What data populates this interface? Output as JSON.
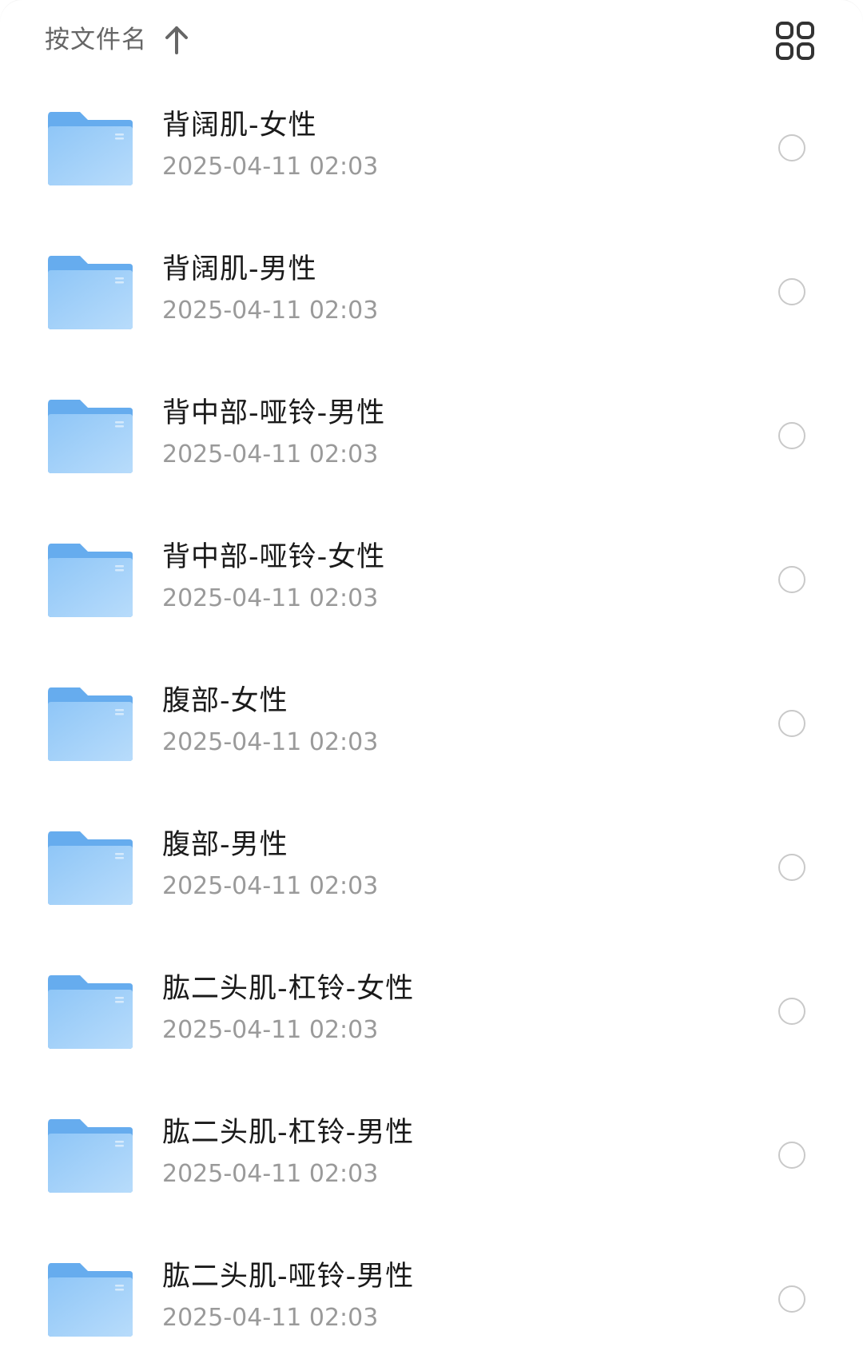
{
  "sortbar": {
    "sort_label": "按文件名",
    "sort_direction_icon": "arrow-up-icon",
    "view_toggle_icon": "grid-view-icon"
  },
  "colors": {
    "folder_light": "#B5DAFB",
    "folder_mid": "#8CC4F6",
    "folder_dark": "#62A9EC",
    "text_primary": "#1a1a1a",
    "text_secondary": "#9a9a9a",
    "header_text": "#666666",
    "circle_border": "#c9c9c9"
  },
  "files": [
    {
      "name": "背阔肌-女性",
      "date": "2025-04-11 02:03",
      "icon": "folder-icon"
    },
    {
      "name": "背阔肌-男性",
      "date": "2025-04-11 02:03",
      "icon": "folder-icon"
    },
    {
      "name": "背中部-哑铃-男性",
      "date": "2025-04-11 02:03",
      "icon": "folder-icon"
    },
    {
      "name": "背中部-哑铃-女性",
      "date": "2025-04-11 02:03",
      "icon": "folder-icon"
    },
    {
      "name": "腹部-女性",
      "date": "2025-04-11 02:03",
      "icon": "folder-icon"
    },
    {
      "name": "腹部-男性",
      "date": "2025-04-11 02:03",
      "icon": "folder-icon"
    },
    {
      "name": "肱二头肌-杠铃-女性",
      "date": "2025-04-11 02:03",
      "icon": "folder-icon"
    },
    {
      "name": "肱二头肌-杠铃-男性",
      "date": "2025-04-11 02:03",
      "icon": "folder-icon"
    },
    {
      "name": "肱二头肌-哑铃-男性",
      "date": "2025-04-11 02:03",
      "icon": "folder-icon"
    }
  ]
}
